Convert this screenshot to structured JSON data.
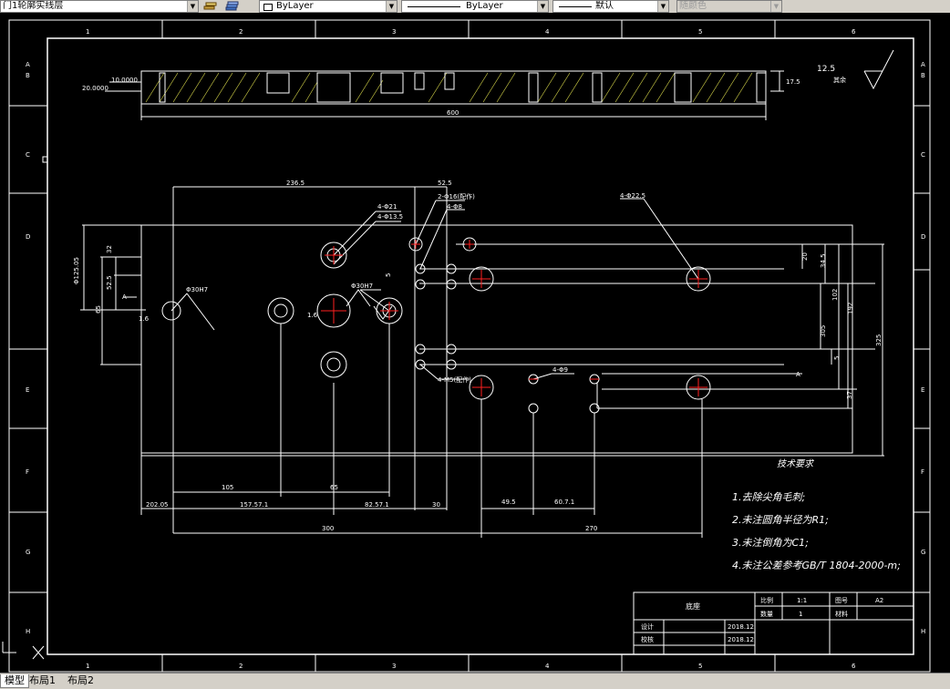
{
  "toolbar": {
    "layer_combo": "门1轮廓实线层",
    "color_combo": "ByLayer",
    "linetype_combo": "ByLayer",
    "lineweight_combo": "默认",
    "plotstyle_combo": "随颜色"
  },
  "tabs": [
    "模型",
    "布局1",
    "布局2"
  ],
  "ruler": {
    "top": [
      "1",
      "2",
      "3",
      "4",
      "5",
      "6"
    ],
    "left": [
      "A",
      "B",
      "C",
      "D",
      "E",
      "F",
      "G",
      "H"
    ]
  },
  "drawing": {
    "roughness": "12.5",
    "roughness_note": "其余",
    "section_dims": {
      "left_a": "20.0000",
      "left_b": "10.0000",
      "right": "17.5",
      "width": "600"
    },
    "dims": [
      "236.5",
      "52.5",
      "4-Φ21",
      "2-Φ16(配作)",
      "4-Φ8",
      "4-Φ13.5",
      "4-Φ22.5",
      "Φ30H7",
      "Φ30H7",
      "Φ125.05",
      "32",
      "52.5",
      "65",
      "1.6",
      "1.6",
      "5",
      "4-M5(配作)",
      "4-Φ9",
      "20",
      "34.5",
      "102",
      "305",
      "192",
      "5",
      "37",
      "325",
      "105",
      "65",
      "202.05",
      "157.57.1",
      "82.57.1",
      "30",
      "49.5",
      "60.7.1",
      "300",
      "270"
    ],
    "datum": "A",
    "datum_right": "A"
  },
  "notes": {
    "title": "技术要求",
    "items": [
      "1.去除尖角毛刺;",
      "2.未注圆角半径为R1;",
      "3.未注倒角为C1;",
      "4.未注公差参考GB/T 1804-2000-m;"
    ]
  },
  "title_block": {
    "part_name": "底座",
    "scale_label": "比例",
    "scale_value": "1:1",
    "qty_label": "数量",
    "qty_value": "1",
    "sheet_label": "图号",
    "sheet_value": "A2",
    "material_label": "材料",
    "designer_label": "设计",
    "designer_date": "2018.12",
    "checker_label": "校核",
    "checker_date": "2018.12"
  },
  "colors": {
    "background": "#000000",
    "line": "#ffffff",
    "center": "#ff0000",
    "hatch": "#d8d84a"
  }
}
